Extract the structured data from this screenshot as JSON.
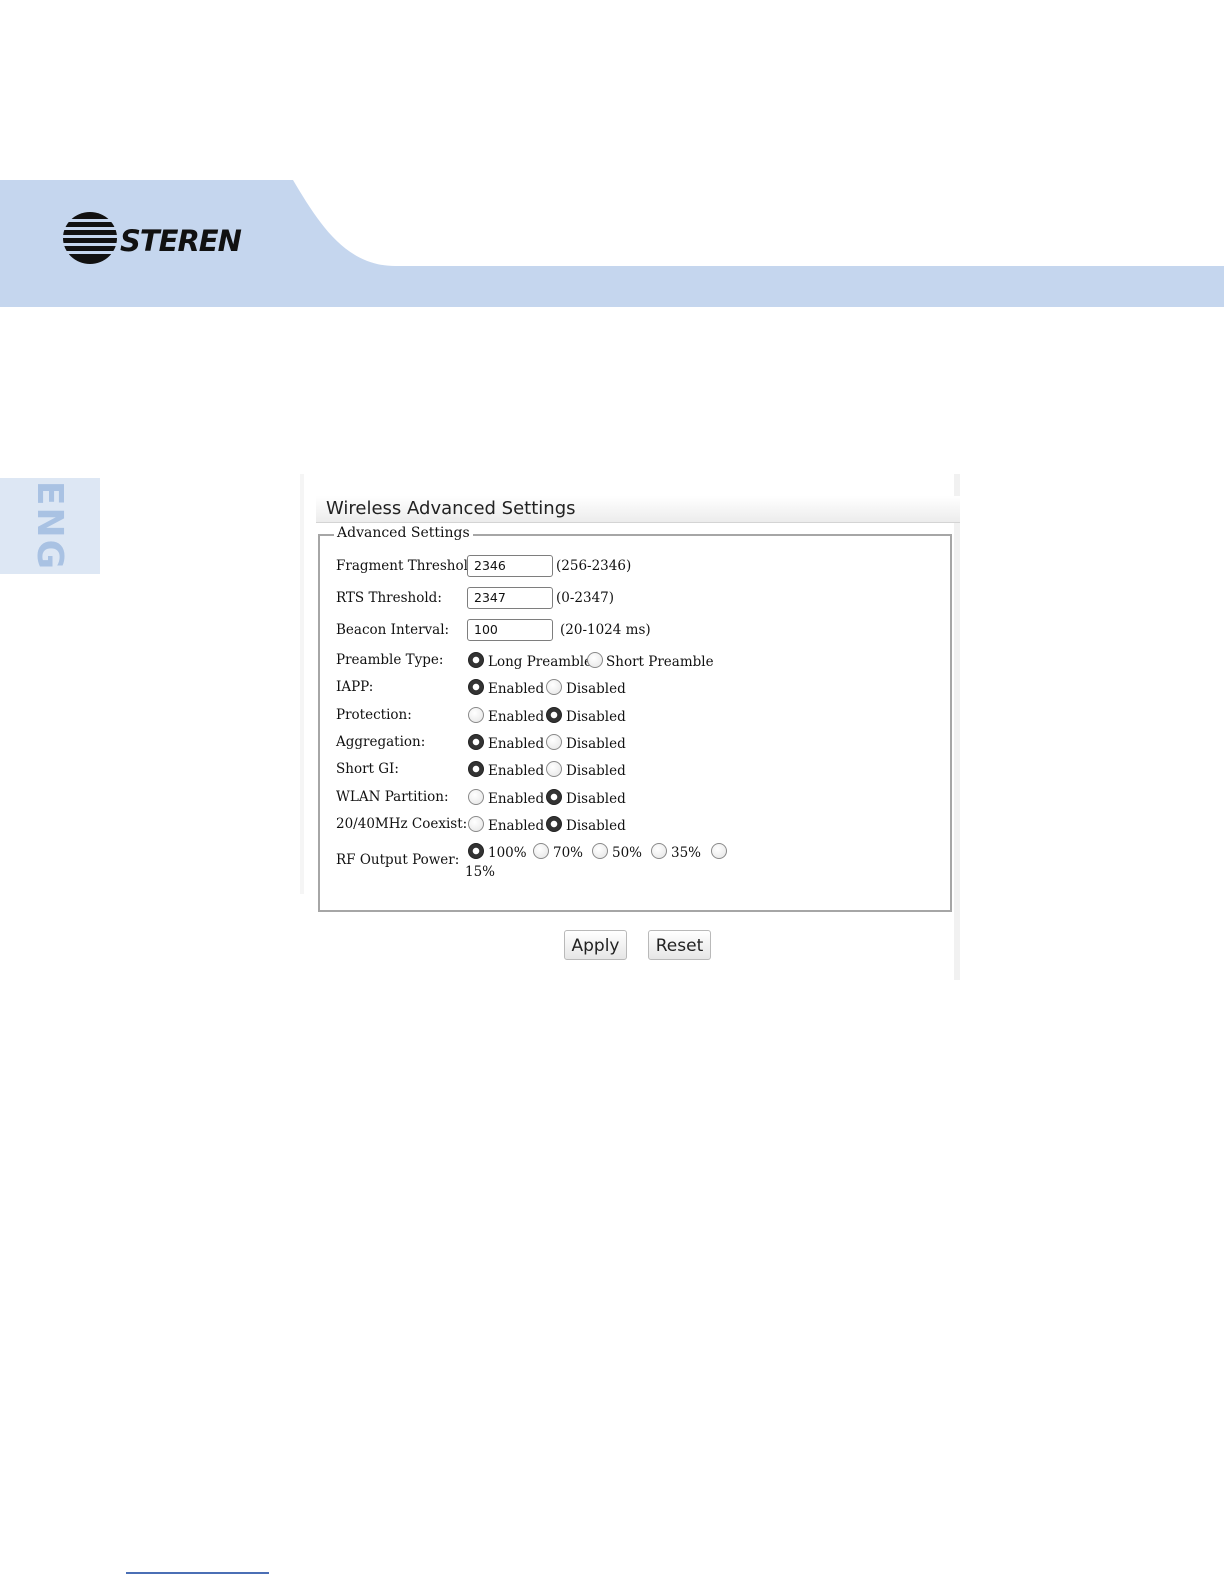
{
  "brand": {
    "name": "STEREN",
    "band_color": "#c5d6ee",
    "lang_tab_color": "#dde7f4"
  },
  "lang_tab": {
    "label": "ENG"
  },
  "panel": {
    "title": "Wireless Advanced Settings",
    "legend": "Advanced Settings",
    "fields": {
      "fragment": {
        "label": "Fragment Threshold:",
        "value": "2346",
        "hint": "(256-2346)"
      },
      "rts": {
        "label": "RTS Threshold:",
        "value": "2347",
        "hint": "(0-2347)"
      },
      "beacon": {
        "label": "Beacon Interval:",
        "value": "100",
        "hint": "(20-1024 ms)"
      }
    },
    "radios": {
      "preamble": {
        "label": "Preamble Type:",
        "opt1": "Long Preamble",
        "opt2": "Short Preamble",
        "selected": "Long Preamble"
      },
      "iapp": {
        "label": "IAPP:",
        "opt1": "Enabled",
        "opt2": "Disabled",
        "selected": "Enabled"
      },
      "protection": {
        "label": "Protection:",
        "opt1": "Enabled",
        "opt2": "Disabled",
        "selected": "Disabled"
      },
      "aggregation": {
        "label": "Aggregation:",
        "opt1": "Enabled",
        "opt2": "Disabled",
        "selected": "Enabled"
      },
      "shortgi": {
        "label": "Short GI:",
        "opt1": "Enabled",
        "opt2": "Disabled",
        "selected": "Enabled"
      },
      "wlanpart": {
        "label": "WLAN Partition:",
        "opt1": "Enabled",
        "opt2": "Disabled",
        "selected": "Disabled"
      },
      "coexist": {
        "label": "20/40MHz Coexist:",
        "opt1": "Enabled",
        "opt2": "Disabled",
        "selected": "Disabled"
      },
      "rfpower": {
        "label": "RF Output Power:",
        "opt1": "100%",
        "opt2": "70%",
        "opt3": "50%",
        "opt4": "35%",
        "opt5": "15%",
        "selected": "100%"
      }
    },
    "buttons": {
      "apply": "Apply",
      "reset": "Reset"
    }
  }
}
